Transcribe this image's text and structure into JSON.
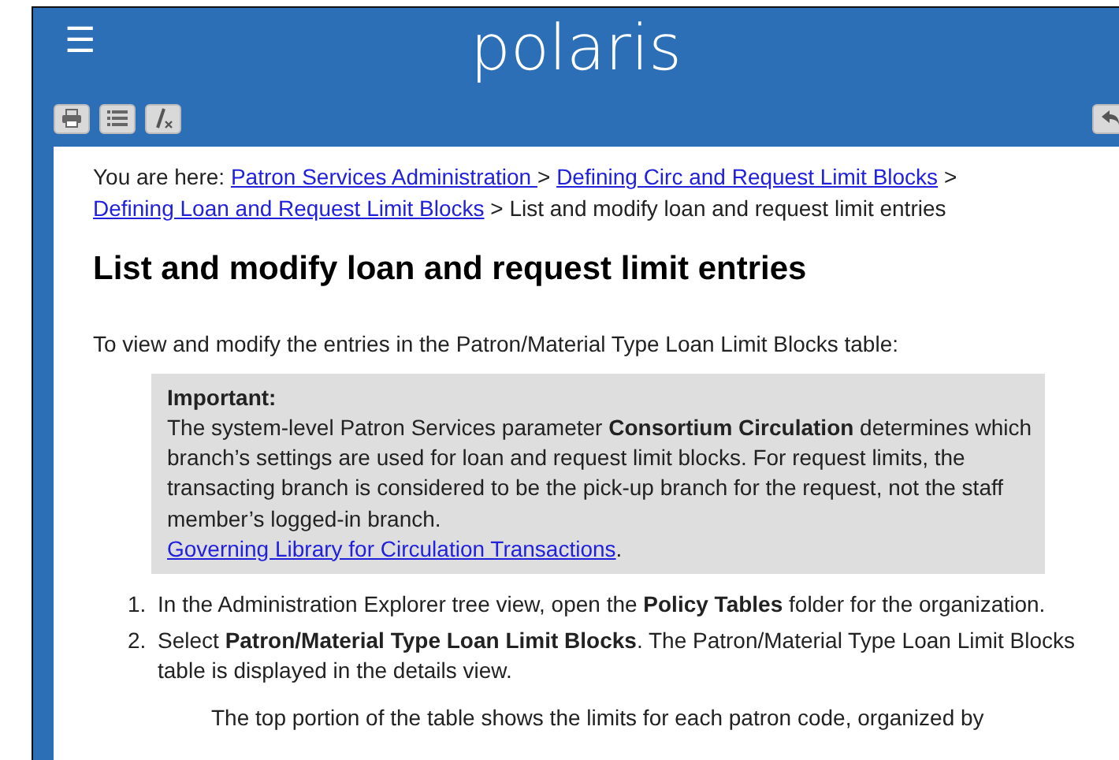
{
  "header": {
    "menu_icon": "☰",
    "logo": "polaris"
  },
  "toolbar": {
    "buttons": [
      {
        "kind": "print"
      },
      {
        "kind": "list"
      },
      {
        "kind": "clear"
      }
    ],
    "right_buttons": [
      {
        "kind": "back"
      }
    ]
  },
  "breadcrumb": [
    {
      "kind": "text",
      "text": "You are here: "
    },
    {
      "kind": "link",
      "text": "Patron Services Administration "
    },
    {
      "kind": "text",
      "text": " > "
    },
    {
      "kind": "link",
      "text": "Defining Circ and Request Limit Blocks"
    },
    {
      "kind": "text",
      "text": " > "
    },
    {
      "kind": "link",
      "text": "Defining Loan and Request Limit Blocks"
    },
    {
      "kind": "text",
      "text": " > List and modify loan and request limit entries"
    }
  ],
  "title": "List and modify loan and request limit entries",
  "intro": "To view and modify the entries in the Patron/Material Type Loan Limit Blocks table:",
  "note": {
    "heading": "Important:",
    "text": "The system-level Patron Services parameter **Consortium Circulation** determines which branch’s settings are used for loan and request limit blocks. For request limits, the transacting branch is considered to be the pick-up branch for the request, not the staff member’s logged-in branch.",
    "link": "Governing Library for Circulation Transactions",
    "after_link": "."
  },
  "steps": [
    {
      "number": "1.",
      "text": "In the Administration Explorer tree view, open the **Policy Tables** folder for the organization."
    },
    {
      "number": "2.",
      "text": "Select **Patron/Material Type Loan Limit Blocks**. The Patron/Material Type Loan Limit Blocks table is displayed in the details view."
    }
  ],
  "step_note": "The top portion of the table shows the limits for each patron code, organized by"
}
